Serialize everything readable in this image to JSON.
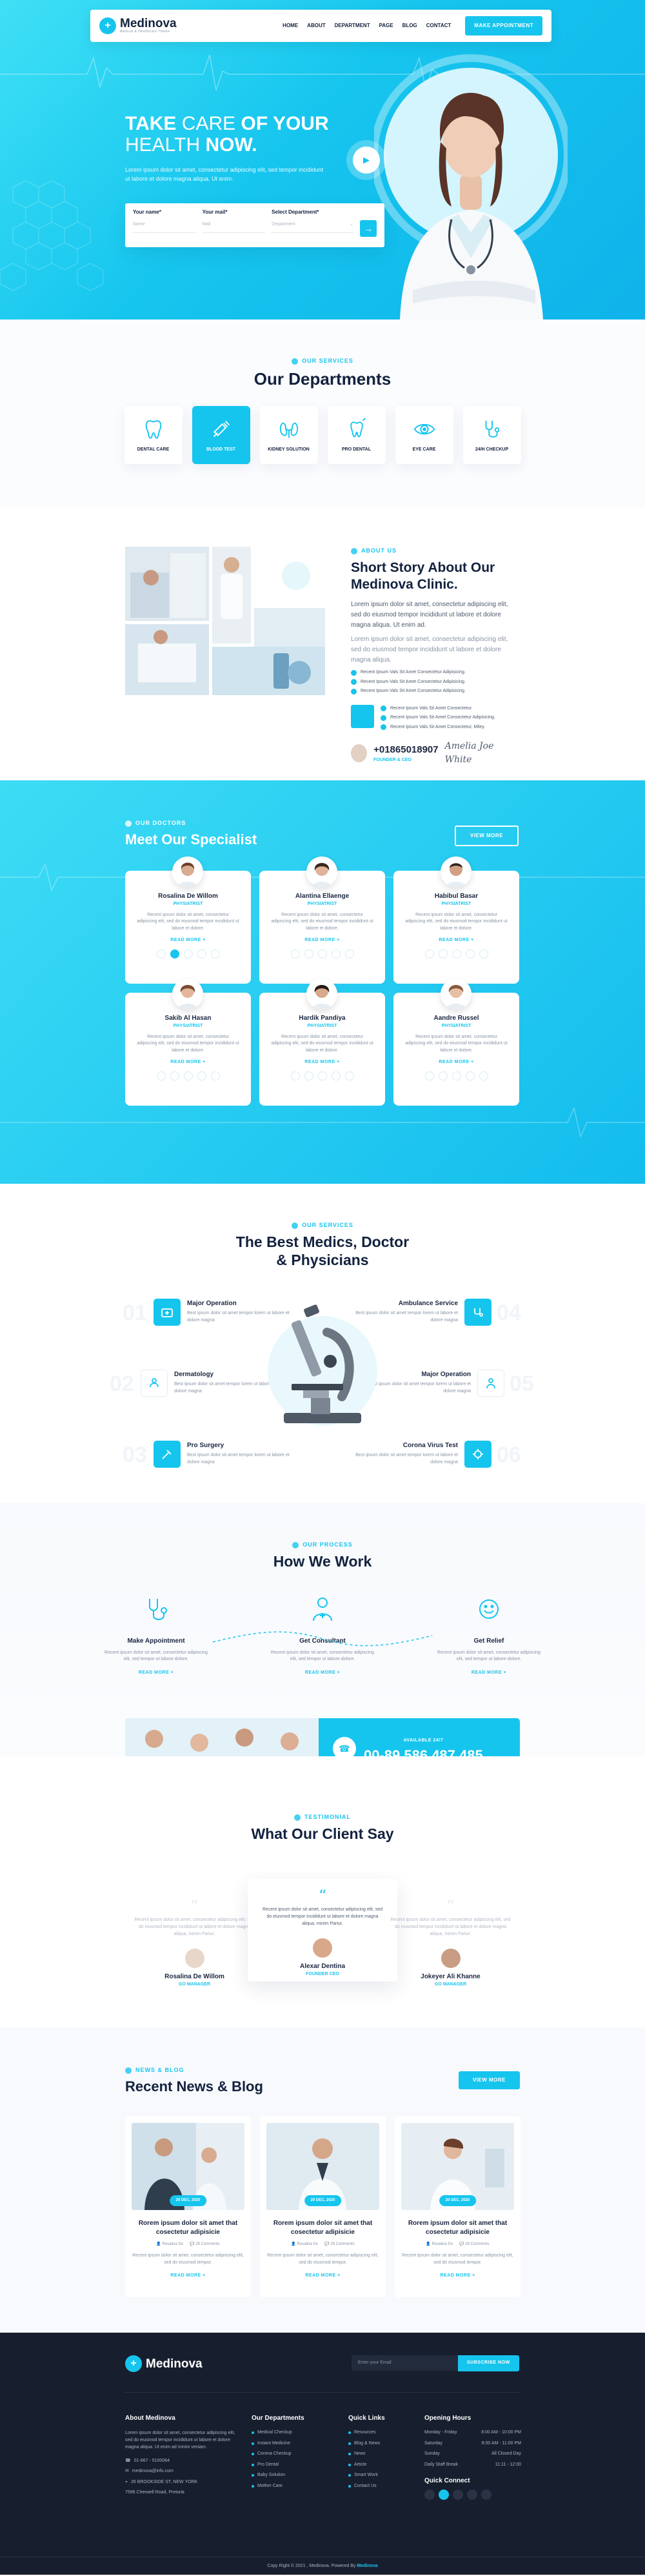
{
  "brand": {
    "name": "Medinova",
    "tagline": "Medical & Healthcare Theme",
    "accent": "#16c5ee",
    "dark": "#171f2e"
  },
  "nav": {
    "links": [
      "HOME",
      "ABOUT",
      "DEPARTMENT",
      "PAGE",
      "BLOG",
      "CONTACT"
    ],
    "cta": "MAKE APPOINTMENT"
  },
  "hero": {
    "title_bold_1": "TAKE",
    "title_light_1": " CARE ",
    "title_bold_2": "OF YOUR",
    "title_light_2": "HEALTH ",
    "title_bold_3": "NOW.",
    "subtitle": "Lorem ipsum dolor sit amet, consectetur adipiscing elit, sed tempor incididunt ut labore et dolore magna aliqua. Ut enim.",
    "form": {
      "name_label": "Your name*",
      "name_placeholder": "Name",
      "mail_label": "Your mail*",
      "mail_placeholder": "Mail",
      "dept_label": "Select Department*",
      "dept_placeholder": "Department"
    }
  },
  "departments": {
    "eyebrow": "OUR SERVICES",
    "title": "Our Departments",
    "items": [
      "DENTAL CARE",
      "BLOOD TEST",
      "KIDNEY SOLUTION",
      "PRO DENTAL",
      "EYE CARE",
      "24/H CHECKUP"
    ]
  },
  "about": {
    "eyebrow": "ABOUT US",
    "title": "Short Story About Our Medinova Clinic.",
    "para1": "Lorem ipsum dolor sit amet, consectetur adipiscing elit, sed do eiusmod tempor incididunt ut labore et dolore magna aliqua. Ut enim ad.",
    "para2": "Lorem ipsum dolor sit amet, consectetur adipiscing elit, sed do eiusmod tempor incididunt ut labore et dolore magna aliqua.",
    "checks": [
      "Recent Ipsum Vals Sit Amet Consectetur Adipisicing.",
      "Recent Ipsum Vals Sit Amet Consectetur Adipisicing.",
      "Recent Ipsum Vals Sit Amet Consectetur Adipisicing."
    ],
    "checks2": [
      "Recent Ipsum Vals Sit Amet Consectetur.",
      "Recent Ipsum Vals Sit Amet Consectetur Adipisicing.",
      "Recent Ipsum Vals Sit Amet Consectetur, Miley."
    ],
    "phone": "+01865018907",
    "phone_sub": "FOUNDER & CEO",
    "signature": "Amelia Joe White"
  },
  "specialists": {
    "eyebrow": "OUR DOCTORS",
    "title": "Meet Our Specialist",
    "button": "VIEW MORE",
    "read_more": "READ MORE +",
    "bio": "Recent ipsum dolor sit amet, consectetur adipiscing elit, sed do eiusmod tempor incididunt ut labore et dolore.",
    "doctors": [
      {
        "name": "Rosalina De Willom",
        "role": "PHYSIATRIST"
      },
      {
        "name": "Alantina Ellaenge",
        "role": "PHYSIATRIST"
      },
      {
        "name": "Habibul Basar",
        "role": "PHYSIATRIST"
      },
      {
        "name": "Sakib Al Hasan",
        "role": "PHYSIATRIST"
      },
      {
        "name": "Hardik Pandiya",
        "role": "PHYSIATRIST"
      },
      {
        "name": "Aandre Russel",
        "role": "PHYSIATRIST"
      }
    ]
  },
  "services": {
    "eyebrow": "OUR SERVICES",
    "title_1": "The Best Medics, Doctor",
    "title_2": "& Physicians",
    "desc": "Best ipsum dolor sit amet tempor lorem ut labore et dolore magna",
    "left": [
      {
        "title": "Major Operation",
        "num": "01"
      },
      {
        "title": "Dermatology",
        "num": "02"
      },
      {
        "title": "Pro Surgery",
        "num": "03"
      }
    ],
    "right": [
      {
        "title": "Ambulance Service",
        "num": "04"
      },
      {
        "title": "Major Operation",
        "num": "05"
      },
      {
        "title": "Corona Virus Test",
        "num": "06"
      }
    ]
  },
  "howwork": {
    "eyebrow": "OUR PROCESS",
    "title": "How We Work",
    "desc": "Recent ipsum dolor sit amet, consectetur adipiscing elit, sed tempor ut labore dolore.",
    "read_more": "READ MORE +",
    "steps": [
      "Make Appointment",
      "Get Consultant",
      "Get Relief"
    ]
  },
  "callbar": {
    "label": "AVAILABLE 24/7",
    "number": "00-89 586 487 485"
  },
  "testimonials": {
    "eyebrow": "TESTIMONIAL",
    "title": "What Our Client Say",
    "text": "Recent ipsum dolor sit amet, consectetur adipiscing elit, sed do eiusmod tempor incididunt ut labore et dolore magna aliqua. minim Pariur.",
    "clients": [
      {
        "name": "Rosalina De Willom",
        "role": "GO MANAGER"
      },
      {
        "name": "Alexar Dentina",
        "role": "FOUNDER CEO"
      },
      {
        "name": "Jokeyer Ali Khanne",
        "role": "GO MANAGER"
      }
    ]
  },
  "blog": {
    "eyebrow": "NEWS & BLOG",
    "title": "Recent News & Blog",
    "button": "VIEW MORE",
    "read_more": "READ MORE +",
    "post_title": "Rorem ipsum dolor sit amet that cosectetur adipisicie",
    "author": "Rosalina Do",
    "comments": "28 Comments",
    "excerpt": "Recent ipsum dolor sit amet, consectetur adipiscing elit, sed do eiusmod tempor.",
    "dates": [
      "20 DEC, 2020",
      "20 DEC, 2020",
      "20 DEC, 2020"
    ]
  },
  "footer": {
    "newsletter_placeholder": "Enter your Email",
    "newsletter_button": "SUBSCRIBE NOW",
    "about_title": "About Medinova",
    "about_text": "Lorem ipsum dolor sit amet, consectetur adipiscing elit, sed do eiusmod tempor incididunt ut labore et dolore magna aliqua. Ut enim ad minim veniam.",
    "phone": "01-867 - 5100064",
    "email": "medinova@info.com",
    "address": "26 BROOKSIDE ST, NEW YORK",
    "address2": "7596 Cherwell Road, Pretoria",
    "departments_title": "Our Departments",
    "departments": [
      "Medical Checkup",
      "Instant Medicine",
      "Corona Checkup",
      "Pro Dental",
      "Baby Solution",
      "Mother Care"
    ],
    "links_title": "Quick Links",
    "links": [
      "Resources",
      "Blog & News",
      "News",
      "Article",
      "Smart Work",
      "Contact Us"
    ],
    "hours_title": "Opening Hours",
    "hours": [
      {
        "day": "Monday - Friday",
        "time": "8:00 AM - 10:00 PM"
      },
      {
        "day": "Saturday",
        "time": "8:00 AM - 11:00 PM"
      },
      {
        "day": "Sunday",
        "time": "All Closed Day"
      },
      {
        "day": "Daily Staff Break",
        "time": "11:11 - 12:00"
      }
    ],
    "connect_title": "Quick Connect",
    "copyright_pre": "Copy Right © 2021 , Medinova. Powered By ",
    "copyright_brand": "Medinova"
  }
}
